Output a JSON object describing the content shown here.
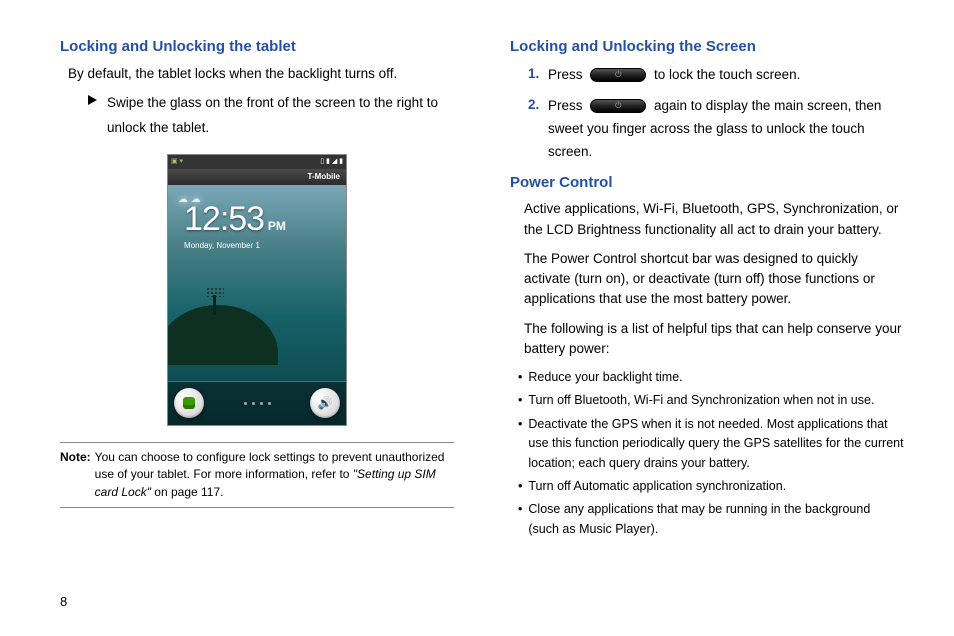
{
  "left": {
    "heading1": "Locking and Unlocking the tablet",
    "intro": "By default, the tablet locks when the backlight turns off.",
    "arrowText": "Swipe the glass on the front of the screen to the right to unlock the tablet.",
    "phone": {
      "carrier": "T-Mobile",
      "time": "12:53",
      "ampm": "PM",
      "date": "Monday, November 1"
    },
    "noteLabel": "Note:",
    "noteText1": "You can choose to configure lock settings to prevent unauthorized use of your tablet. For more information, refer to ",
    "noteRef": "\"Setting up SIM card Lock\"",
    "noteText2": " on page 117."
  },
  "right": {
    "heading1": "Locking and Unlocking the Screen",
    "step1a": "Press ",
    "step1b": " to lock the touch screen.",
    "step2a": "Press ",
    "step2b": " again to display the main screen, then sweet you finger across the glass to unlock the touch screen.",
    "heading2": "Power Control",
    "p1": "Active applications, Wi-Fi, Bluetooth, GPS, Synchronization, or the LCD Brightness functionality all act to drain your battery.",
    "p2": "The Power Control shortcut bar was designed to quickly activate (turn on), or deactivate (turn off) those functions or applications that use the most battery power.",
    "p3": "The following is a list of helpful tips that can help conserve your battery power:",
    "bullets": [
      "Reduce your backlight time.",
      "Turn off Bluetooth, Wi-Fi and Synchronization when not in use.",
      "Deactivate the GPS when it is not needed. Most applications that use this function periodically query the GPS satellites for the current location; each query drains your battery.",
      "Turn off Automatic application synchronization.",
      "Close any applications that may be running in the background (such as Music Player)."
    ]
  },
  "pageNumber": "8"
}
